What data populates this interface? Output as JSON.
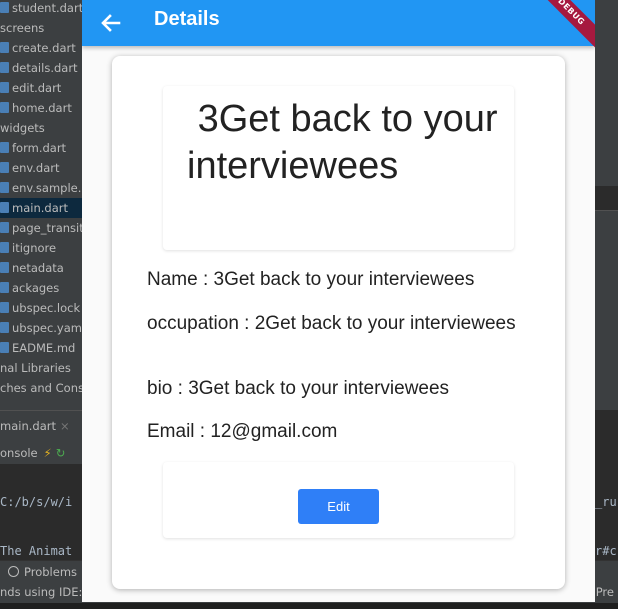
{
  "ide": {
    "project_tree": [
      {
        "label": "student.dart",
        "type": "file",
        "selected": false
      },
      {
        "label": "screens",
        "type": "folder",
        "selected": false
      },
      {
        "label": "create.dart",
        "type": "file",
        "selected": false
      },
      {
        "label": "details.dart",
        "type": "file",
        "selected": false
      },
      {
        "label": "edit.dart",
        "type": "file",
        "selected": false
      },
      {
        "label": "home.dart",
        "type": "file",
        "selected": false
      },
      {
        "label": "widgets",
        "type": "folder",
        "selected": false
      },
      {
        "label": "form.dart",
        "type": "file",
        "selected": false
      },
      {
        "label": "env.dart",
        "type": "file",
        "selected": false
      },
      {
        "label": "env.sample.dart",
        "type": "file",
        "selected": false
      },
      {
        "label": "main.dart",
        "type": "file",
        "selected": true
      },
      {
        "label": "page_transition",
        "type": "file",
        "selected": false
      },
      {
        "label": "itignore",
        "type": "file",
        "selected": false
      },
      {
        "label": "netadata",
        "type": "file",
        "selected": false
      },
      {
        "label": "ackages",
        "type": "file",
        "selected": false
      },
      {
        "label": "ubspec.lock",
        "type": "file",
        "selected": false
      },
      {
        "label": "ubspec.yaml",
        "type": "file",
        "selected": false
      },
      {
        "label": "EADME.md",
        "type": "file",
        "selected": false
      },
      {
        "label": "nal Libraries",
        "type": "folder",
        "selected": false
      },
      {
        "label": "ches and Conso",
        "type": "folder",
        "selected": false
      }
    ],
    "open_tab": "main.dart",
    "open_tab_close": "×",
    "console_label": "onsole",
    "console_lines_left": [
      "C:/b/s/w/i",
      "The Animat",
      "=========="
    ],
    "console_lines_right": [
      "_ru",
      "r#c",
      "==="
    ],
    "problems_label": "Problems",
    "status_left": "nds using IDE: k",
    "status_right": ". Pre"
  },
  "app": {
    "title": "Details",
    "back_icon": "arrow-back-icon",
    "debug_banner": "DEBUG",
    "student": {
      "heading": " 3Get back to your interviewees",
      "name": "Name : 3Get back to your interviewees",
      "occupation": "occupation : 2Get back to your interviewees",
      "bio": "bio : 3Get back to your interviewees",
      "email": "Email : 12@gmail.com"
    },
    "edit_label": "Edit"
  },
  "colors": {
    "app_bar": "#2196f3",
    "edit_button": "#2f7ff7",
    "debug_banner": "#a6193f",
    "ide_panel": "#3c3f41",
    "ide_editor": "#2b2b2b"
  }
}
